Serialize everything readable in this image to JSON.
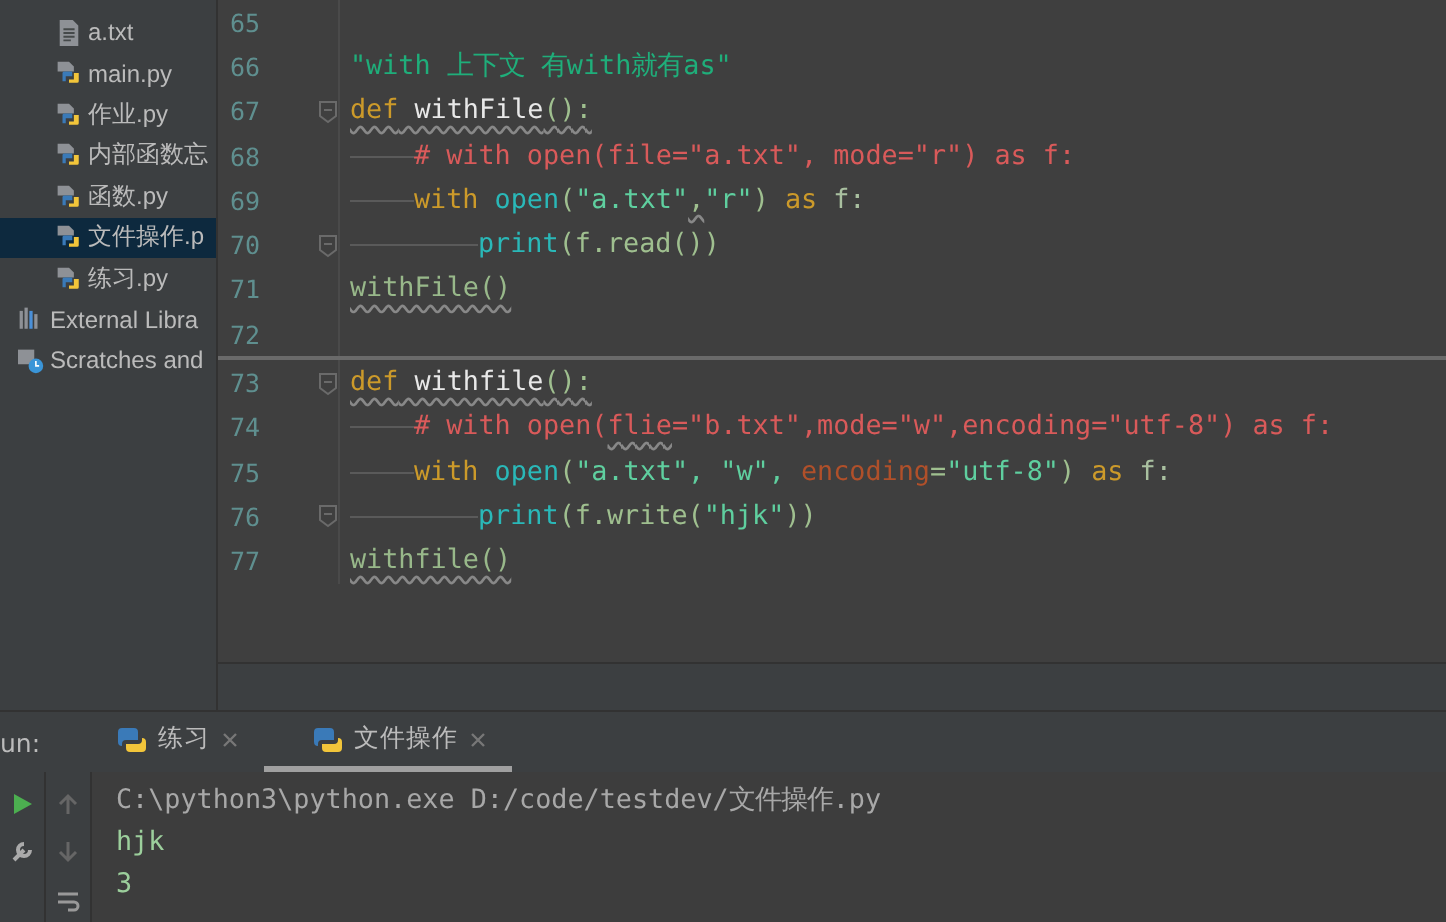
{
  "project": {
    "items": [
      {
        "label": "a.txt",
        "kind": "text",
        "selected": false
      },
      {
        "label": "main.py",
        "kind": "python",
        "selected": false
      },
      {
        "label": "作业.py",
        "kind": "python",
        "selected": false
      },
      {
        "label": "内部函数忘",
        "kind": "python",
        "selected": false
      },
      {
        "label": "函数.py",
        "kind": "python",
        "selected": false
      },
      {
        "label": "文件操作.p",
        "kind": "python",
        "selected": true
      },
      {
        "label": "练习.py",
        "kind": "python",
        "selected": false
      },
      {
        "label": "External Libra",
        "kind": "library",
        "selected": false
      },
      {
        "label": "Scratches and",
        "kind": "scratch",
        "selected": false
      }
    ]
  },
  "editor": {
    "lines": [
      {
        "number": "65",
        "kind": "top",
        "fold": false,
        "separator": false
      },
      {
        "number": "66",
        "kind": "top",
        "fold": false,
        "separator": false,
        "tokens": [
          {
            "text": "\"with 上下文 有with就有as\"",
            "kind": "docstring",
            "warned": false
          }
        ]
      },
      {
        "number": "67",
        "kind": "top",
        "fold": true,
        "separator": false,
        "tokens": [
          {
            "text": "def",
            "kind": "keyword",
            "warned": true
          },
          {
            "text": " withFile",
            "kind": "name",
            "warned": true
          },
          {
            "text": "():",
            "kind": "punct",
            "warned": true
          }
        ]
      },
      {
        "number": "68",
        "kind": "body",
        "fold": false,
        "separator": false,
        "tokens": [
          {
            "text": "# with open(file=\"a.txt\", mode=\"r\") as f:",
            "kind": "comment",
            "warned": false
          }
        ]
      },
      {
        "number": "69",
        "kind": "body",
        "fold": false,
        "separator": false,
        "tokens": [
          {
            "text": "with",
            "kind": "keyword",
            "warned": false
          },
          {
            "text": " open",
            "kind": "builtin",
            "warned": false
          },
          {
            "text": "(",
            "kind": "punct",
            "warned": false
          },
          {
            "text": "\"a.txt\"",
            "kind": "string",
            "warned": false
          },
          {
            "text": ",",
            "kind": "punct",
            "warned": true
          },
          {
            "text": "\"r\"",
            "kind": "string",
            "warned": false
          },
          {
            "text": ") ",
            "kind": "punct",
            "warned": false
          },
          {
            "text": "as",
            "kind": "keyword",
            "warned": false
          },
          {
            "text": " f:",
            "kind": "var",
            "warned": false
          }
        ]
      },
      {
        "number": "70",
        "kind": "nested",
        "fold": true,
        "separator": false,
        "tokens": [
          {
            "text": "print",
            "kind": "builtin",
            "warned": false
          },
          {
            "text": "(f.read())",
            "kind": "punct",
            "warned": false
          }
        ]
      },
      {
        "number": "71",
        "kind": "top",
        "fold": false,
        "separator": false,
        "tokens": [
          {
            "text": "withFile()",
            "kind": "call",
            "warned": true
          }
        ]
      },
      {
        "number": "72",
        "kind": "top",
        "fold": false,
        "separator": false
      },
      {
        "number": "73",
        "kind": "top",
        "fold": true,
        "separator": true,
        "tokens": [
          {
            "text": "def",
            "kind": "keyword",
            "warned": true
          },
          {
            "text": " withfile",
            "kind": "name",
            "warned": true
          },
          {
            "text": "():",
            "kind": "punct",
            "warned": true
          }
        ]
      },
      {
        "number": "74",
        "kind": "body",
        "fold": false,
        "separator": false,
        "tokens": [
          {
            "text": "# with open(",
            "kind": "comment",
            "warned": false
          },
          {
            "text": "flie",
            "kind": "comment",
            "warned": true
          },
          {
            "text": "=\"b.txt\",mode=\"w\",encoding=\"utf-8\") as f:",
            "kind": "comment",
            "warned": false
          }
        ]
      },
      {
        "number": "75",
        "kind": "body",
        "fold": false,
        "separator": false,
        "tokens": [
          {
            "text": "with",
            "kind": "keyword",
            "warned": false
          },
          {
            "text": " open",
            "kind": "builtin",
            "warned": false
          },
          {
            "text": "(",
            "kind": "punct",
            "warned": false
          },
          {
            "text": "\"a.txt\", \"w\", ",
            "kind": "string",
            "warned": false
          },
          {
            "text": "encoding",
            "kind": "param",
            "warned": false
          },
          {
            "text": "=",
            "kind": "punct",
            "warned": false
          },
          {
            "text": "\"utf-8\"",
            "kind": "string",
            "warned": false
          },
          {
            "text": ") ",
            "kind": "punct",
            "warned": false
          },
          {
            "text": "as",
            "kind": "keyword",
            "warned": false
          },
          {
            "text": " f:",
            "kind": "var",
            "warned": false
          }
        ]
      },
      {
        "number": "76",
        "kind": "nested",
        "fold": true,
        "separator": false,
        "tokens": [
          {
            "text": "print",
            "kind": "builtin",
            "warned": false
          },
          {
            "text": "(f.write(",
            "kind": "punct",
            "warned": false
          },
          {
            "text": "\"hjk\"",
            "kind": "string",
            "warned": false
          },
          {
            "text": "))",
            "kind": "punct",
            "warned": false
          }
        ]
      },
      {
        "number": "77",
        "kind": "top",
        "fold": false,
        "separator": false,
        "tokens": [
          {
            "text": "withfile()",
            "kind": "call",
            "warned": true
          }
        ]
      }
    ]
  },
  "run": {
    "label": "un:",
    "tabs": [
      {
        "label": "练习",
        "selected": false
      },
      {
        "label": "文件操作",
        "selected": true
      }
    ],
    "console": [
      {
        "text": "C:\\python3\\python.exe D:/code/testdev/文件操作.py",
        "kind": "command"
      },
      {
        "text": "hjk",
        "kind": "output"
      },
      {
        "text": "3",
        "kind": "output"
      }
    ]
  }
}
